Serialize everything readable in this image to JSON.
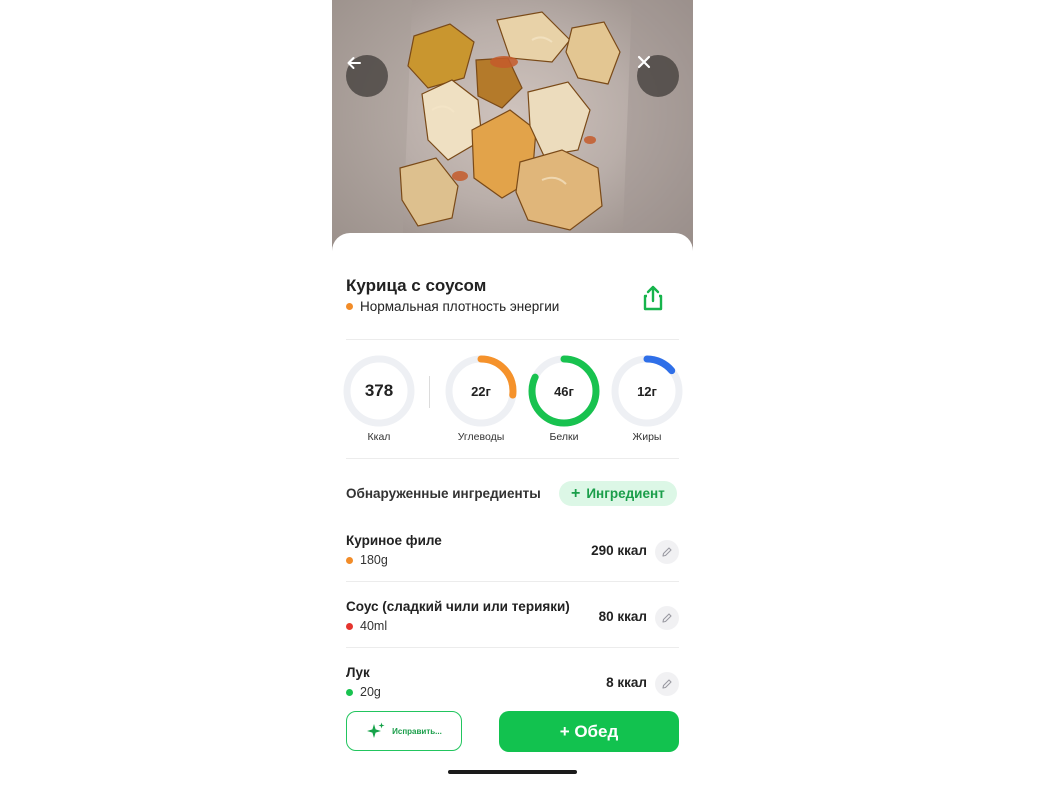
{
  "header": {
    "back_icon": "arrow-left-icon",
    "close_icon": "close-icon"
  },
  "dish": {
    "title": "Курица с соусом",
    "density_label": "Нормальная плотность энергии",
    "density_color": "#f28c28",
    "share_icon": "share-icon"
  },
  "nutrition": {
    "calories": {
      "value": "378",
      "label": "Ккал"
    },
    "carbs": {
      "value": "22г",
      "label": "Углеводы",
      "color": "#f5922b",
      "progress": 0.27
    },
    "protein": {
      "value": "46г",
      "label": "Белки",
      "color": "#18c24f",
      "progress": 0.82
    },
    "fat": {
      "value": "12г",
      "label": "Жиры",
      "color": "#2f6fe8",
      "progress": 0.14
    }
  },
  "ingredients": {
    "heading": "Обнаруженные ингредиенты",
    "add_label": "Ингредиент",
    "items": [
      {
        "name": "Куриное филе",
        "amount": "180g",
        "kcal": "290 ккал",
        "dot_color": "#f28c28"
      },
      {
        "name": "Соус (сладкий чили или терияки)",
        "amount": "40ml",
        "kcal": "80 ккал",
        "dot_color": "#e5342e"
      },
      {
        "name": "Лук",
        "amount": "20g",
        "kcal": "8 ккал",
        "dot_color": "#18c24f"
      }
    ]
  },
  "actions": {
    "fix_label": "Исправить...",
    "meal_label": "+ Обед"
  },
  "colors": {
    "accent": "#12c24f"
  }
}
